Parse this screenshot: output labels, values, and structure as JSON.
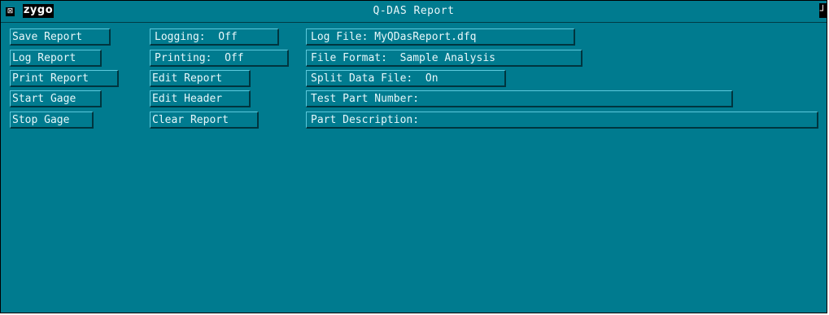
{
  "window": {
    "title": "Q-DAS Report",
    "logo_text": "zygo",
    "close_glyph": "⊠",
    "pin_glyph": "┘"
  },
  "col1": {
    "save_report": "Save Report",
    "log_report": "Log Report",
    "print_report": "Print Report",
    "start_gage": "Start Gage",
    "stop_gage": "Stop Gage"
  },
  "col2": {
    "logging": "Logging:  Off",
    "printing": "Printing:  Off",
    "edit_report": "Edit Report",
    "edit_header": "Edit Header",
    "clear_report": "Clear Report"
  },
  "col3": {
    "log_file": "Log File: MyQDasReport.dfq",
    "file_format": "File Format:  Sample Analysis",
    "split_data_file": "Split Data File:  On",
    "test_part_number": "Test Part Number:",
    "part_description": "Part Description:"
  },
  "colors": {
    "background": "#007b8f",
    "text": "#e8f7fa",
    "bevel_light": "#5cc9dc",
    "bevel_dark": "#00353f"
  }
}
